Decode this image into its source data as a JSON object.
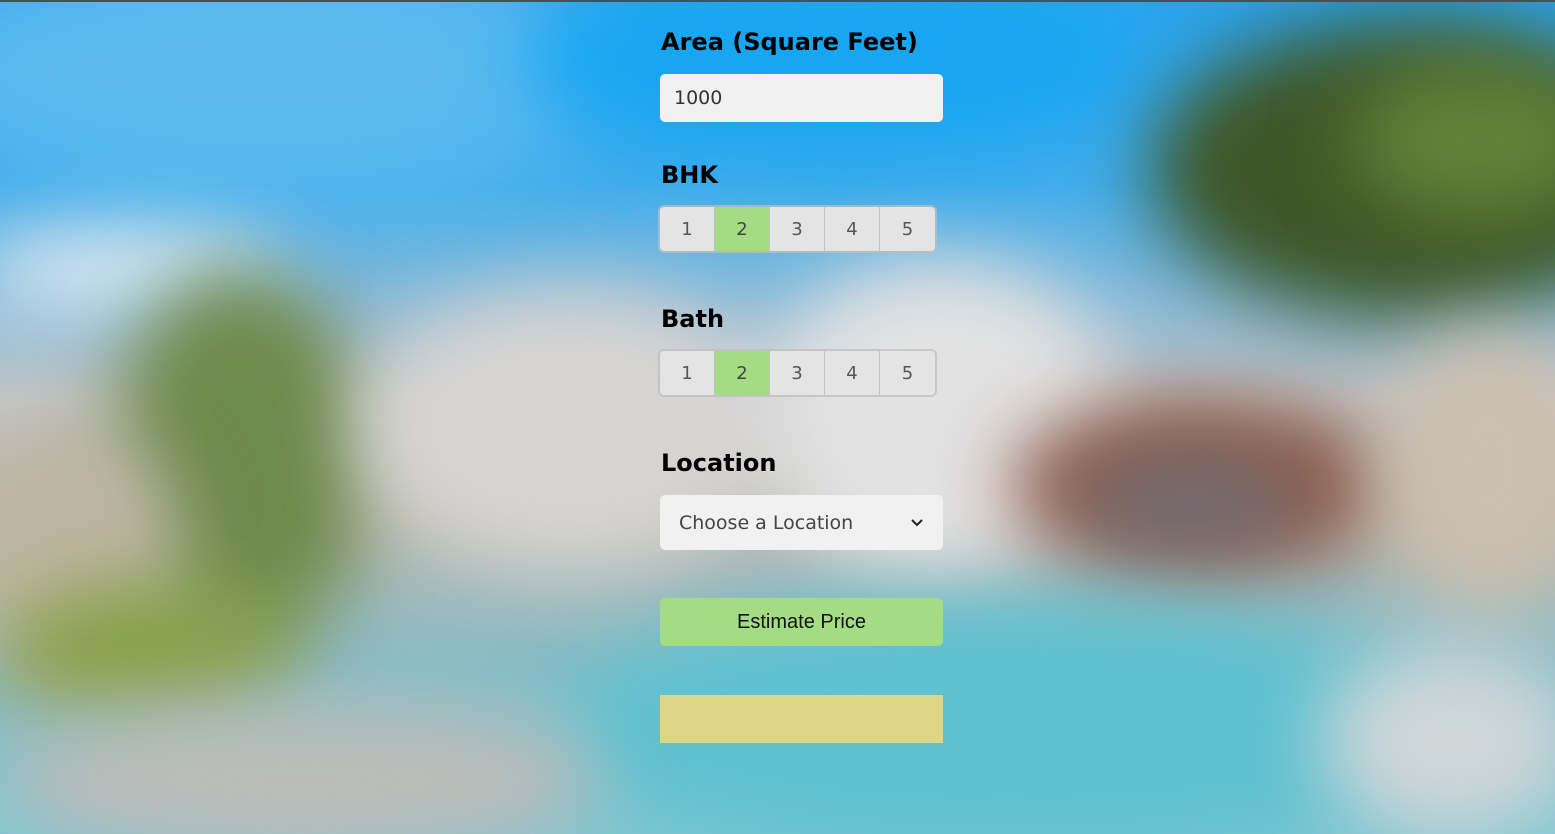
{
  "colors": {
    "selected_option": "#a4dc86",
    "button": "#a4dc86",
    "result_box": "#dcd689",
    "input_bg": "#f1f1f1"
  },
  "area": {
    "label": "Area (Square Feet)",
    "value": "1000"
  },
  "bhk": {
    "label": "BHK",
    "options": [
      "1",
      "2",
      "3",
      "4",
      "5"
    ],
    "selected": "2"
  },
  "bath": {
    "label": "Bath",
    "options": [
      "1",
      "2",
      "3",
      "4",
      "5"
    ],
    "selected": "2"
  },
  "location": {
    "label": "Location",
    "selected": "Choose a Location",
    "icon": "chevron-down-icon"
  },
  "estimate": {
    "button_label": "Estimate Price"
  },
  "result": {
    "text": ""
  }
}
